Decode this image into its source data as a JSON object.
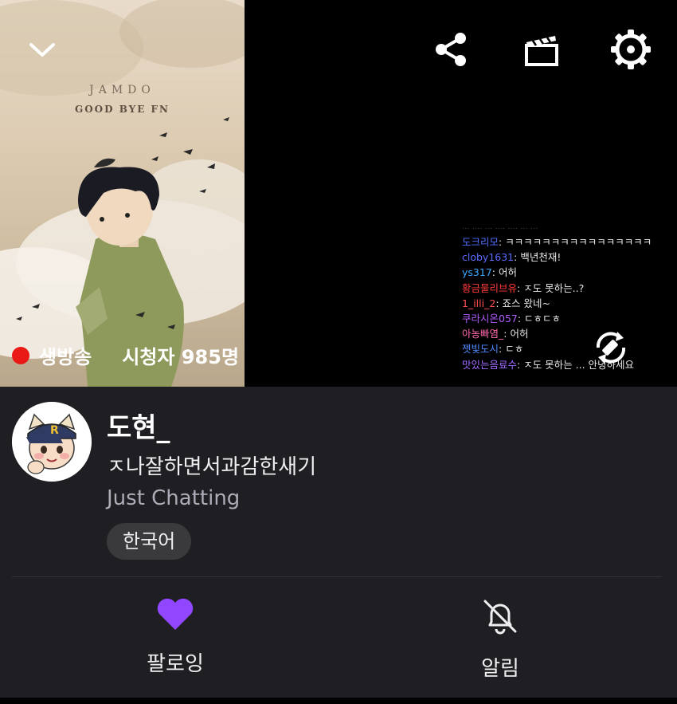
{
  "player": {
    "art_brand": "JAMDO",
    "art_subtitle": "GOOD BYE FN",
    "live_label": "생방송",
    "viewers_label": "시청자 985명"
  },
  "chat": [
    {
      "user": "도크리모",
      "user_color": "#4f6fff",
      "text": "ㅋㅋㅋㅋㅋㅋㅋㅋㅋㅋㅋㅋㅋㅋㅋㅋ"
    },
    {
      "user": "cloby1631",
      "user_color": "#5b6cff",
      "text": "백년천재!"
    },
    {
      "user": "ys317",
      "user_color": "#3ea8ff",
      "text": "어허"
    },
    {
      "user": "황금물리브유",
      "user_color": "#ff3a3a",
      "text": "ㅈ도 못하는..?"
    },
    {
      "user": "1_illi_2",
      "user_color": "#ff4d4d",
      "text": "죠스 왔네~"
    },
    {
      "user": "쿠라시온057",
      "user_color": "#b15cff",
      "text": "ㄷㅎㄷㅎ"
    },
    {
      "user": "아농빠염_",
      "user_color": "#ff6ab0",
      "text": "어허"
    },
    {
      "user": "젯빛도시",
      "user_color": "#4f8bff",
      "text": "ㄷㅎ"
    },
    {
      "user": "맛있는음료수",
      "user_color": "#a06bff",
      "text": "ㅈ도 못하는 ... 안녕하세요"
    }
  ],
  "channel": {
    "name": "도현_",
    "stream_title": "ㅈ나잘하면서과감한새기",
    "category": "Just Chatting",
    "tag": "한국어"
  },
  "actions": {
    "follow_label": "팔로잉",
    "notify_label": "알림"
  },
  "colors": {
    "accent": "#9147ff",
    "live": "#e91916",
    "background": "#1f1f23"
  },
  "icons": [
    "chevron-down-icon",
    "share-icon",
    "clip-icon",
    "gear-icon",
    "rotate-screen-icon",
    "heart-icon",
    "bell-off-icon"
  ]
}
